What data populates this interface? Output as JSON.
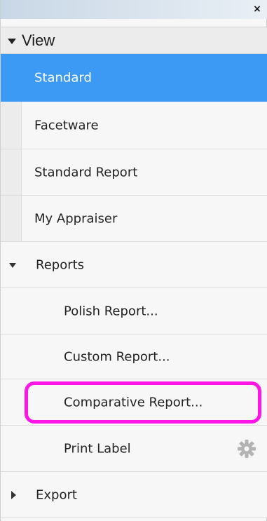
{
  "titlebar": {
    "close_label": "×"
  },
  "view": {
    "label": "View"
  },
  "view_items": [
    {
      "label": "Standard",
      "selected": true
    },
    {
      "label": "Facetware"
    },
    {
      "label": "Standard Report"
    },
    {
      "label": "My Appraiser"
    }
  ],
  "reports": {
    "label": "Reports",
    "items": [
      {
        "label": "Polish Report..."
      },
      {
        "label": "Custom Report..."
      },
      {
        "label": "Comparative Report..."
      },
      {
        "label": "Print Label"
      }
    ]
  },
  "export": {
    "label": "Export"
  },
  "colors": {
    "selected": "#3d9af4",
    "highlight": "#ff16e6",
    "gear": "#b3b3b3"
  },
  "icons": [
    "close-icon",
    "caret-down-icon",
    "caret-right-icon",
    "gear-icon"
  ]
}
